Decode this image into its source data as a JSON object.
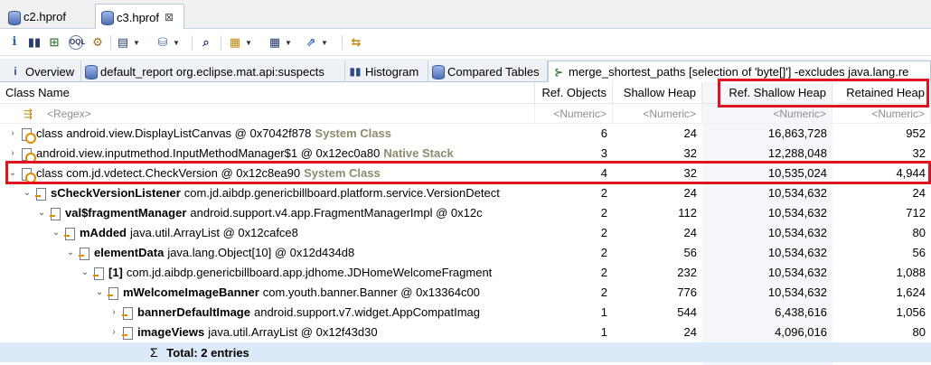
{
  "editor_tabs": [
    {
      "label": "c2.hprof",
      "active": false
    },
    {
      "label": "c3.hprof",
      "active": true,
      "close": "⊠"
    }
  ],
  "toolbar": {
    "items": [
      "info-icon",
      "histogram-icon",
      "dominator-tree-icon",
      "oql-icon",
      "heap-dump-overview-icon",
      "run-report-icon",
      "query-browser-icon",
      "search-icon",
      "group-by-icon",
      "calculate-retained-icon",
      "export-icon",
      "compare-icon"
    ]
  },
  "view_tabs": [
    {
      "icon": "i",
      "label": "Overview"
    },
    {
      "icon": "db",
      "label": "default_report  org.eclipse.mat.api:suspects"
    },
    {
      "icon": "hist",
      "label": "Histogram"
    },
    {
      "icon": "db",
      "label": "Compared Tables"
    },
    {
      "icon": "path",
      "label": "merge_shortest_paths [selection of 'byte[]'] -excludes java.lang.re"
    }
  ],
  "columns": {
    "name": "Class Name",
    "ref_objects": "Ref. Objects",
    "shallow": "Shallow Heap",
    "ref_shallow": "Ref. Shallow Heap",
    "retained": "Retained Heap"
  },
  "filters": {
    "name": "<Regex>",
    "ref_objects": "<Numeric>",
    "shallow": "<Numeric>",
    "ref_shallow": "<Numeric>",
    "retained": "<Numeric>"
  },
  "rows": [
    {
      "indent": 0,
      "twisty": "›",
      "icon": "cls",
      "bold": "",
      "text": "class android.view.DisplayListCanvas @ 0x7042f878",
      "tag": "System Class",
      "ref_objects": "6",
      "shallow": "24",
      "ref_shallow": "16,863,728",
      "retained": "952"
    },
    {
      "indent": 0,
      "twisty": "›",
      "icon": "cls",
      "bold": "",
      "text": "android.view.inputmethod.InputMethodManager$1 @ 0x12ec0a80",
      "tag": "Native Stack",
      "ref_objects": "3",
      "shallow": "32",
      "ref_shallow": "12,288,048",
      "retained": "32"
    },
    {
      "indent": 0,
      "twisty": "⌄",
      "icon": "cls",
      "bold": "",
      "text": "class com.jd.vdetect.CheckVersion @ 0x12c8ea90",
      "tag": "System Class",
      "ref_objects": "4",
      "shallow": "32",
      "ref_shallow": "10,535,024",
      "retained": "4,944"
    },
    {
      "indent": 1,
      "twisty": "⌄",
      "icon": "field",
      "bold": "sCheckVersionListener",
      "text": "com.jd.aibdp.genericbillboard.platform.service.VersionDetect",
      "tag": "",
      "ref_objects": "2",
      "shallow": "24",
      "ref_shallow": "10,534,632",
      "retained": "24"
    },
    {
      "indent": 2,
      "twisty": "⌄",
      "icon": "field",
      "bold": "val$fragmentManager",
      "text": "android.support.v4.app.FragmentManagerImpl @ 0x12c",
      "tag": "",
      "ref_objects": "2",
      "shallow": "112",
      "ref_shallow": "10,534,632",
      "retained": "712"
    },
    {
      "indent": 3,
      "twisty": "⌄",
      "icon": "field",
      "bold": "mAdded",
      "text": "java.util.ArrayList @ 0x12cafce8",
      "tag": "",
      "ref_objects": "2",
      "shallow": "24",
      "ref_shallow": "10,534,632",
      "retained": "80"
    },
    {
      "indent": 4,
      "twisty": "⌄",
      "icon": "field",
      "bold": "elementData",
      "text": "java.lang.Object[10] @ 0x12d434d8",
      "tag": "",
      "ref_objects": "2",
      "shallow": "56",
      "ref_shallow": "10,534,632",
      "retained": "56"
    },
    {
      "indent": 5,
      "twisty": "⌄",
      "icon": "field",
      "bold": "[1]",
      "text": "com.jd.aibdp.genericbillboard.app.jdhome.JDHomeWelcomeFragment",
      "tag": "",
      "ref_objects": "2",
      "shallow": "232",
      "ref_shallow": "10,534,632",
      "retained": "1,088"
    },
    {
      "indent": 6,
      "twisty": "⌄",
      "icon": "field",
      "bold": "mWelcomeImageBanner",
      "text": "com.youth.banner.Banner @ 0x13364c00",
      "tag": "",
      "ref_objects": "2",
      "shallow": "776",
      "ref_shallow": "10,534,632",
      "retained": "1,624"
    },
    {
      "indent": 7,
      "twisty": "›",
      "icon": "field",
      "bold": "bannerDefaultImage",
      "text": "android.support.v7.widget.AppCompatImag",
      "tag": "",
      "ref_objects": "1",
      "shallow": "544",
      "ref_shallow": "6,438,616",
      "retained": "1,056"
    },
    {
      "indent": 7,
      "twisty": "›",
      "icon": "field",
      "bold": "imageViews",
      "text": "java.util.ArrayList @ 0x12f43d30",
      "tag": "",
      "ref_objects": "1",
      "shallow": "24",
      "ref_shallow": "4,096,016",
      "retained": "80"
    }
  ],
  "total": {
    "sigma": "Σ",
    "label": "Total: 2 entries"
  }
}
